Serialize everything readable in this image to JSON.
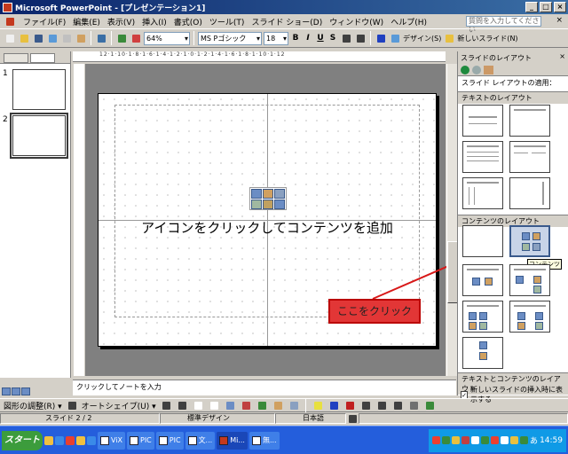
{
  "window": {
    "title": "Microsoft PowerPoint - [プレゼンテーション1]",
    "min": "_",
    "max": "□",
    "close": "×"
  },
  "menu": {
    "items": [
      "ファイル(F)",
      "編集(E)",
      "表示(V)",
      "挿入(I)",
      "書式(O)",
      "ツール(T)",
      "スライド ショー(D)",
      "ウィンドウ(W)",
      "ヘルプ(H)"
    ],
    "help_placeholder": "質問を入力してください",
    "doc_close": "×"
  },
  "toolbar": {
    "zoom": "64%",
    "font": "MS Pゴシック",
    "size": "18",
    "bold": "B",
    "italic": "I",
    "underline": "U",
    "shadow": "S",
    "design_label": "デザイン(S)",
    "new_slide_label": "新しいスライド(N)"
  },
  "ruler": {
    "top_ticks": "12·1·10·1·8·1·6·1·4·1·2·1·0·1·2·1·4·1·6·1·8·1·10·1·12"
  },
  "outline": {
    "slides": [
      {
        "num": "1"
      },
      {
        "num": "2"
      }
    ]
  },
  "slide": {
    "placeholder_text": "アイコンをクリックしてコンテンツを追加"
  },
  "annotation": {
    "label": "ここをクリック"
  },
  "task_pane": {
    "title": "スライドのレイアウト",
    "close": "×",
    "apply_label": "スライド レイアウトの適用：",
    "sections": [
      "テキストのレイアウト",
      "コンテンツのレイアウト",
      "テキストとコンテンツのレイアウト"
    ],
    "tooltip": "コンテンツ",
    "checkbox_label": "新しいスライドの挿入時に表示する",
    "checkbox_mark": "✓"
  },
  "notes": {
    "placeholder": "クリックしてノートを入力"
  },
  "draw_toolbar": {
    "draw_label": "図形の調整(R) ▾",
    "autoshape_label": "オートシェイプ(U) ▾"
  },
  "status": {
    "slide": "スライド 2 / 2",
    "design": "標準デザイン",
    "language": "日本語"
  },
  "taskbar": {
    "start": "スタート",
    "buttons": [
      "ViX",
      "PIC",
      "PIC",
      "文...",
      "Mi...",
      "無..."
    ],
    "clock": "14:59",
    "ime": "あ"
  },
  "colors": {
    "annotation_fill": "#e23636",
    "annotation_circle": "#d81818",
    "selection_blue": "#3a5a8c"
  }
}
